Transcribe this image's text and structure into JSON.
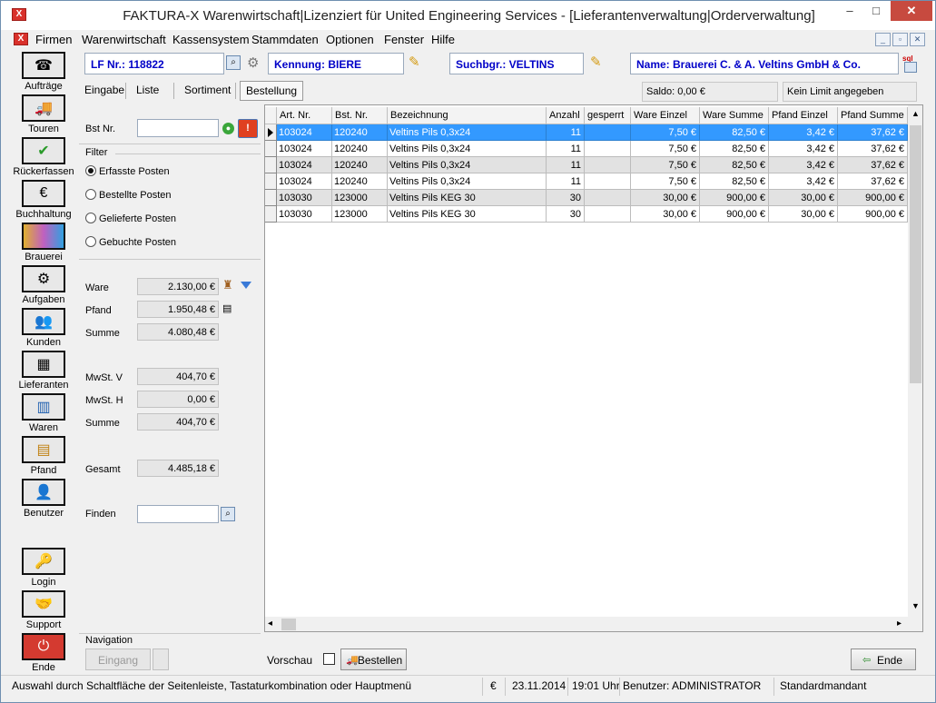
{
  "window": {
    "app_icon": "X",
    "title": "FAKTURA-X Warenwirtschaft|Lizenziert für United Engineering Services - [Lieferantenverwaltung|Orderverwaltung]",
    "minimize": "–",
    "maximize": "□",
    "close": "✕"
  },
  "menu": [
    "Firmen",
    "Warenwirtschaft",
    "Kassensystem",
    "Stammdaten",
    "Optionen",
    "Fenster",
    "Hilfe"
  ],
  "mdi_controls": [
    "_",
    "▫",
    "✕"
  ],
  "sidebar": [
    {
      "label": "Aufträge",
      "icon": "phone-operator-icon"
    },
    {
      "label": "Touren",
      "icon": "truck-icon"
    },
    {
      "label": "Rückerfassen",
      "icon": "checkmark-icon"
    },
    {
      "label": "Buchhaltung",
      "icon": "money-icon"
    },
    {
      "label": "Brauerei",
      "icon": "brewery-icon"
    },
    {
      "label": "Aufgaben",
      "icon": "tasks-icon"
    },
    {
      "label": "Kunden",
      "icon": "customers-icon"
    },
    {
      "label": "Lieferanten",
      "icon": "suppliers-icon"
    },
    {
      "label": "Waren",
      "icon": "goods-icon"
    },
    {
      "label": "Pfand",
      "icon": "crates-icon"
    },
    {
      "label": "Benutzer",
      "icon": "user-icon"
    },
    {
      "label": "Login",
      "icon": "key-icon"
    },
    {
      "label": "Support",
      "icon": "handshake-icon"
    },
    {
      "label": "Ende",
      "icon": "power-icon"
    }
  ],
  "header": {
    "lf_nr": "LF Nr.: 118822",
    "kennung": "Kennung: BIERE",
    "suchbgr": "Suchbgr.: VELTINS",
    "name": "Name: Brauerei C. & A. Veltins GmbH & Co.",
    "sql_badge": "sql"
  },
  "tabs": [
    "Eingabe",
    "Liste",
    "Sortiment",
    "Bestellung"
  ],
  "active_tab": "Bestellung",
  "saldo": "Saldo: 0,00 €",
  "limit": "Kein Limit angegeben",
  "left": {
    "bst_nr_label": "Bst Nr.",
    "bst_nr_value": "",
    "filter_label": "Filter",
    "filters": [
      "Erfasste Posten",
      "Bestellte Posten",
      "Gelieferte Posten",
      "Gebuchte Posten"
    ],
    "selected_filter": "Erfasste Posten",
    "ware_label": "Ware",
    "ware": "2.130,00 €",
    "pfand_label": "Pfand",
    "pfand": "1.950,48 €",
    "summe_label": "Summe",
    "summe": "4.080,48 €",
    "mwst_v_label": "MwSt. V",
    "mwst_v": "404,70 €",
    "mwst_h_label": "MwSt. H",
    "mwst_h": "0,00 €",
    "summe2_label": "Summe",
    "summe2": "404,70 €",
    "gesamt_label": "Gesamt",
    "gesamt": "4.485,18 €",
    "finden_label": "Finden",
    "finden_value": ""
  },
  "table": {
    "columns": [
      "Art. Nr.",
      "Bst. Nr.",
      "Bezeichnung",
      "Anzahl",
      "gesperrt",
      "Ware Einzel",
      "Ware Summe",
      "Pfand Einzel",
      "Pfand Summe"
    ],
    "rows": [
      [
        "103024",
        "120240",
        "Veltins Pils 0,3x24",
        "11",
        "",
        "7,50 €",
        "82,50 €",
        "3,42 €",
        "37,62 €"
      ],
      [
        "103024",
        "120240",
        "Veltins Pils 0,3x24",
        "11",
        "",
        "7,50 €",
        "82,50 €",
        "3,42 €",
        "37,62 €"
      ],
      [
        "103024",
        "120240",
        "Veltins Pils 0,3x24",
        "11",
        "",
        "7,50 €",
        "82,50 €",
        "3,42 €",
        "37,62 €"
      ],
      [
        "103024",
        "120240",
        "Veltins Pils 0,3x24",
        "11",
        "",
        "7,50 €",
        "82,50 €",
        "3,42 €",
        "37,62 €"
      ],
      [
        "103030",
        "123000",
        "Veltins Pils KEG 30",
        "30",
        "",
        "30,00 €",
        "900,00 €",
        "30,00 €",
        "900,00 €"
      ],
      [
        "103030",
        "123000",
        "Veltins Pils KEG 30",
        "30",
        "",
        "30,00 €",
        "900,00 €",
        "30,00 €",
        "900,00 €"
      ]
    ]
  },
  "bottom": {
    "navigation_label": "Navigation",
    "eingang_button": "Eingang",
    "vorschau_label": "Vorschau",
    "bestellen_button": "Bestellen",
    "ende_button": "Ende"
  },
  "status": {
    "hint": "Auswahl durch Schaltfläche der Seitenleiste, Tastaturkombination oder Hauptmenü",
    "currency": "€",
    "date": "23.11.2014",
    "time": "19:01 Uhr",
    "user": "Benutzer: ADMINISTRATOR",
    "mandant": "Standardmandant"
  },
  "colors": {
    "selection": "#3399ff",
    "header_text": "#0000c8",
    "close_button": "#c74a3f"
  }
}
